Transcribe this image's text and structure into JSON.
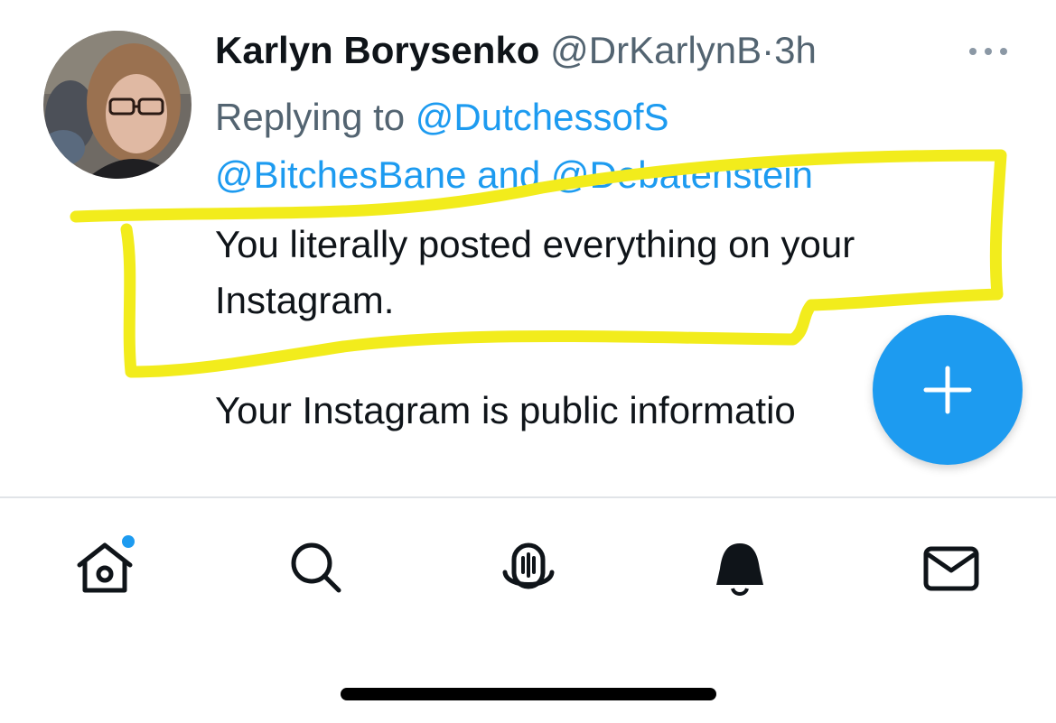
{
  "tweet": {
    "author_name": "Karlyn Borysenko",
    "author_handle": "@DrKarlynB",
    "separator": "·",
    "time": "3h",
    "replying_label": "Replying to",
    "replying_to": [
      "@DutchessofS",
      "@BitchesBane",
      "@Debatenstein"
    ],
    "and_label": "and",
    "text_line1": "You literally posted everything on your",
    "text_line2": "Instagram.",
    "text_para2": "Your Instagram is public informatio"
  },
  "icons": {
    "more": "more-options-icon",
    "compose": "plus-icon",
    "nav": [
      "home-icon",
      "search-icon",
      "spaces-icon",
      "notifications-icon",
      "messages-icon"
    ]
  },
  "colors": {
    "accent": "#1d9bf0",
    "highlight": "#f2ec1c",
    "muted_text": "#536471",
    "text": "#0f1419"
  }
}
